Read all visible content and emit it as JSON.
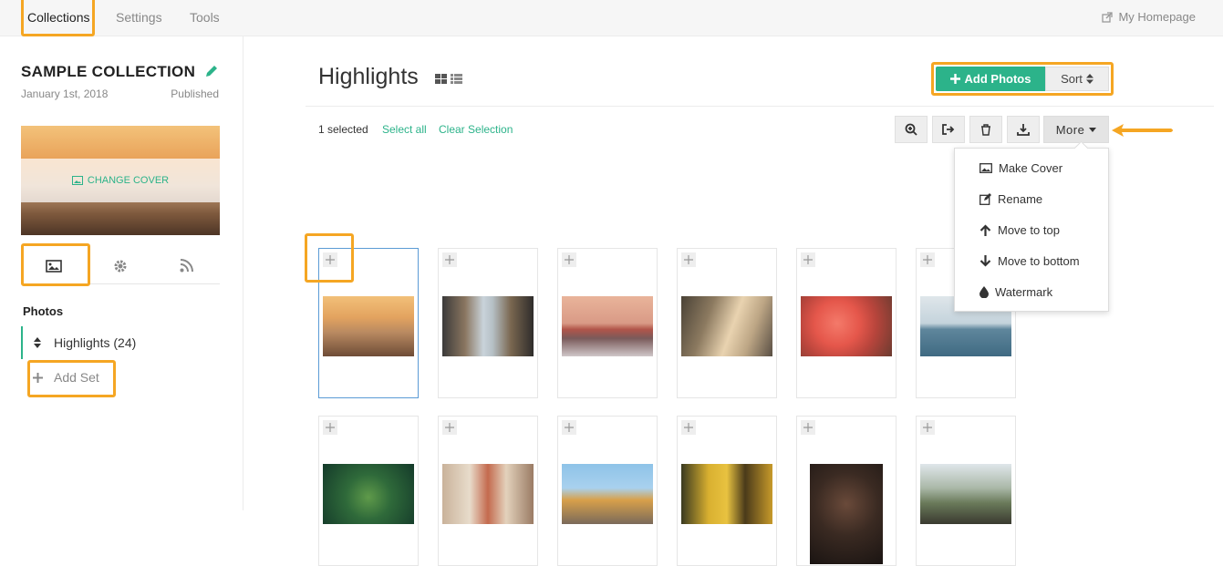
{
  "topbar": {
    "tabs": [
      "Collections",
      "Settings",
      "Tools"
    ],
    "homepage": "My Homepage"
  },
  "sidebar": {
    "collection_title": "SAMPLE COLLECTION",
    "date": "January 1st, 2018",
    "status": "Published",
    "change_cover": "CHANGE COVER",
    "photos_heading": "Photos",
    "set_label": "Highlights (24)",
    "add_set": "Add Set"
  },
  "main": {
    "title": "Highlights",
    "add_photos": "Add Photos",
    "sort": "Sort",
    "selected_count": "1 selected",
    "select_all": "Select all",
    "clear_selection": "Clear Selection",
    "more": "More",
    "menu": [
      "Make Cover",
      "Rename",
      "Move to top",
      "Move to bottom",
      "Watermark"
    ]
  },
  "colors": {
    "accent": "#2cb38a",
    "highlight": "#f5a623",
    "selection": "#5b9bd5"
  }
}
